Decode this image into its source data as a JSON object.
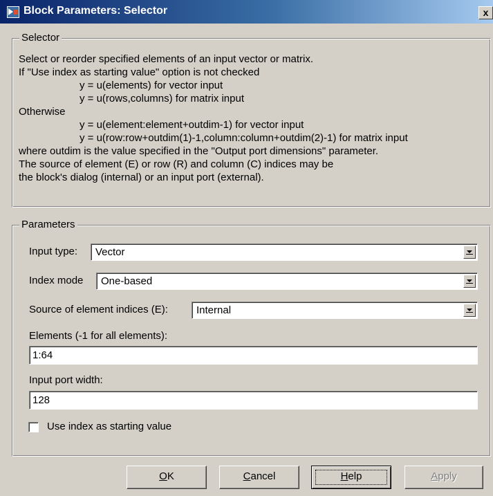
{
  "window": {
    "title": "Block Parameters: Selector",
    "close_label": "x"
  },
  "selector_group": {
    "legend": "Selector",
    "description": [
      "Select or reorder specified elements of an input vector or matrix.",
      "If \"Use index as starting value\" option is not checked",
      "y = u(elements) for vector input",
      "y = u(rows,columns) for matrix input",
      "Otherwise",
      "y = u(element:element+outdim-1) for vector input",
      "y = u(row:row+outdim(1)-1,column:column+outdim(2)-1) for matrix input",
      "where outdim is the value specified in the \"Output port dimensions\" parameter.",
      "The source of element (E) or row (R) and column (C) indices may be",
      "the block's dialog (internal) or an input port (external)."
    ]
  },
  "parameters_group": {
    "legend": "Parameters",
    "input_type": {
      "label": "Input type:",
      "value": "Vector"
    },
    "index_mode": {
      "label": "Index mode",
      "value": "One-based"
    },
    "source_of_indices": {
      "label": "Source of element indices (E):",
      "value": "Internal"
    },
    "elements": {
      "label": "Elements (-1 for all elements):",
      "value": "1:64"
    },
    "input_port_width": {
      "label": "Input port width:",
      "value": "128"
    },
    "use_index_checkbox": {
      "label": "Use index as starting value",
      "checked": false
    }
  },
  "buttons": {
    "ok": {
      "mnemonic": "O",
      "rest": "K"
    },
    "cancel": {
      "mnemonic": "C",
      "rest": "ancel"
    },
    "help": {
      "mnemonic": "H",
      "rest": "elp"
    },
    "apply": {
      "mnemonic": "A",
      "rest": "pply",
      "enabled": false
    }
  },
  "colors": {
    "dialog_bg": "#d4d0c8",
    "titlebar_start": "#0a246a",
    "titlebar_end": "#a6caf0",
    "disabled_text": "#808080"
  },
  "icons": {
    "title": "simulink-block-icon",
    "close": "close-icon",
    "dropdown": "chevron-down-icon"
  }
}
